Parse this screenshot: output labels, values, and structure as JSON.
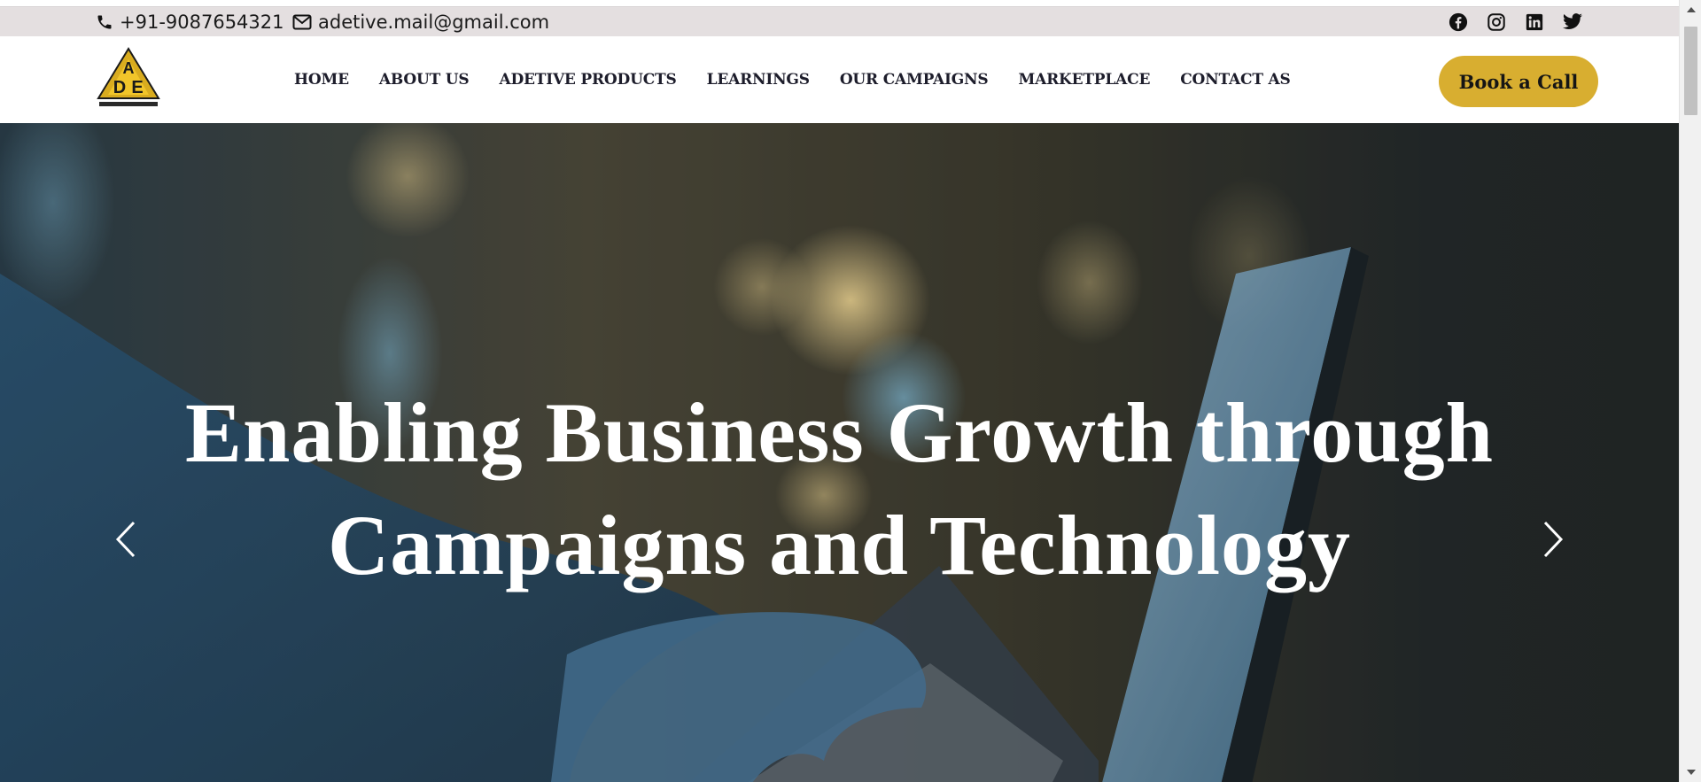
{
  "topbar": {
    "phone": "+91-9087654321",
    "email": "adetive.mail@gmail.com",
    "social": [
      "facebook-icon",
      "instagram-icon",
      "linkedin-icon",
      "twitter-icon"
    ]
  },
  "nav": {
    "items": [
      {
        "label": "HOME"
      },
      {
        "label": "ABOUT US"
      },
      {
        "label": "ADETIVE PRODUCTS"
      },
      {
        "label": "LEARNINGS"
      },
      {
        "label": "OUR CAMPAIGNS"
      },
      {
        "label": "MARKETPLACE"
      },
      {
        "label": "CONTACT AS"
      }
    ],
    "cta_label": "Book a Call"
  },
  "hero": {
    "line1": "Enabling Business Growth through",
    "line2": "Campaigns and Technology"
  },
  "colors": {
    "accent": "#d8ae30",
    "topbar_bg": "#e4dfe0",
    "nav_text": "#1d1d2b"
  }
}
